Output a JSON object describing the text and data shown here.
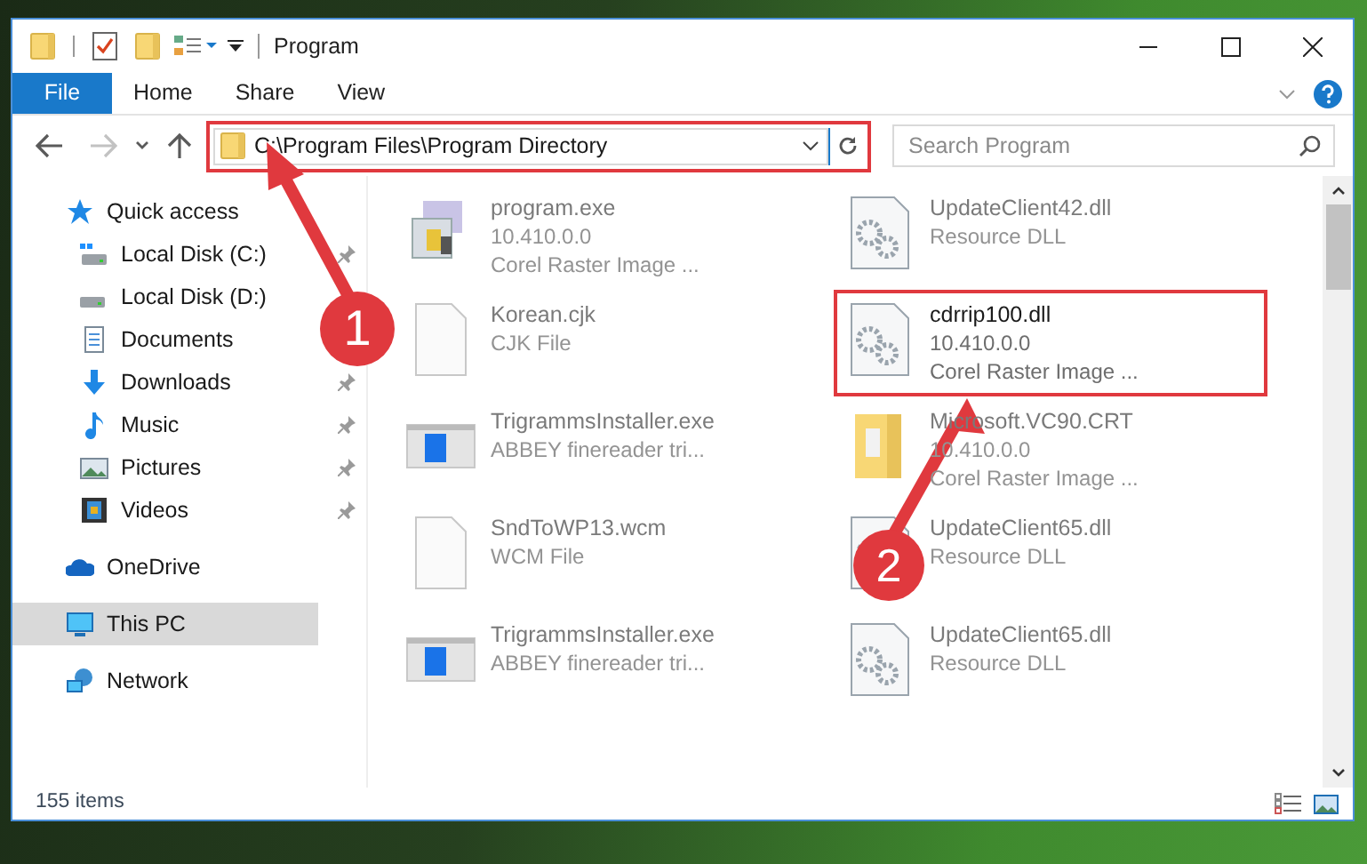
{
  "window": {
    "title": "Program"
  },
  "ribbon_tabs": [
    {
      "label": "File",
      "kind": "menu"
    },
    {
      "label": "Home",
      "kind": "tab"
    },
    {
      "label": "Share",
      "kind": "tab"
    },
    {
      "label": "View",
      "kind": "tab"
    }
  ],
  "navigation": [
    {
      "kind": "back",
      "disabled": false
    },
    {
      "kind": "forward",
      "disabled": true
    },
    {
      "kind": "recent",
      "disabled": false
    },
    {
      "kind": "up",
      "disabled": false
    }
  ],
  "address_bar": {
    "path": "C:\\Program Files\\Program Directory",
    "highlighted": true
  },
  "search": {
    "placeholder": "Search Program"
  },
  "sidebar": {
    "items": [
      {
        "label": "Quick access",
        "kind": "star",
        "selected": false,
        "pinned": false,
        "children": [
          {
            "label": "Local Disk (C:)",
            "kind": "system-drive",
            "selected": false,
            "pinned": true
          },
          {
            "label": "Local Disk (D:)",
            "kind": "drive",
            "selected": false,
            "pinned": false
          },
          {
            "label": "Documents",
            "kind": "document",
            "selected": false,
            "pinned": false
          },
          {
            "label": "Downloads",
            "kind": "download",
            "selected": false,
            "pinned": true
          },
          {
            "label": "Music",
            "kind": "music",
            "selected": false,
            "pinned": true
          },
          {
            "label": "Pictures",
            "kind": "pictures",
            "selected": false,
            "pinned": true
          },
          {
            "label": "Videos",
            "kind": "videos",
            "selected": false,
            "pinned": true
          }
        ]
      },
      {
        "label": "OneDrive",
        "kind": "cloud",
        "selected": false,
        "pinned": false
      },
      {
        "label": "This PC",
        "kind": "computer",
        "selected": true,
        "pinned": false
      },
      {
        "label": "Network",
        "kind": "network",
        "selected": false,
        "pinned": false
      }
    ]
  },
  "files": [
    {
      "name": "program.exe",
      "details": [
        "10.410.0.0",
        "Corel Raster Image ..."
      ],
      "kind": "app",
      "highlighted": false
    },
    {
      "name": "UpdateClient42.dll",
      "details": [
        "Resource DLL"
      ],
      "kind": "dll",
      "highlighted": false
    },
    {
      "name": "Korean.cjk",
      "details": [
        "CJK File"
      ],
      "kind": "blank",
      "highlighted": false
    },
    {
      "name": "cdrrip100.dll",
      "details": [
        "10.410.0.0",
        "Corel Raster Image ..."
      ],
      "kind": "dll",
      "highlighted": true
    },
    {
      "name": "TrigrammsInstaller.exe",
      "details": [
        "ABBEY finereader tri..."
      ],
      "kind": "installer",
      "highlighted": false
    },
    {
      "name": "Microsoft.VC90.CRT",
      "details": [
        "10.410.0.0",
        "Corel Raster Image ..."
      ],
      "kind": "folder",
      "highlighted": false
    },
    {
      "name": "SndToWP13.wcm",
      "details": [
        "WCM File"
      ],
      "kind": "blank",
      "highlighted": false
    },
    {
      "name": "UpdateClient65.dll",
      "details": [
        "Resource DLL"
      ],
      "kind": "dll",
      "highlighted": false
    },
    {
      "name": "TrigrammsInstaller.exe",
      "details": [
        "ABBEY finereader tri..."
      ],
      "kind": "installer",
      "highlighted": false
    },
    {
      "name": "UpdateClient65.dll",
      "details": [
        "Resource DLL"
      ],
      "kind": "dll",
      "highlighted": false
    }
  ],
  "status_bar": {
    "item_count": "155 items"
  },
  "callouts": [
    {
      "number": "1"
    },
    {
      "number": "2"
    }
  ]
}
